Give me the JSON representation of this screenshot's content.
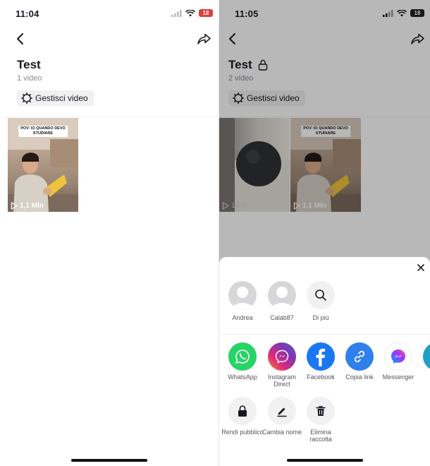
{
  "left_screen": {
    "status_time": "11:04",
    "battery": "18",
    "collection_title": "Test",
    "video_count": "1 video",
    "manage_label": "Gestisci video",
    "videos": [
      {
        "caption": "POV: IO QUANDO DEVO STUDIARE",
        "views": "1,1 Mln"
      }
    ]
  },
  "right_screen": {
    "status_time": "11:05",
    "battery": "18",
    "collection_title": "Test",
    "video_count": "2 video",
    "manage_label": "Gestisci video",
    "videos": [
      {
        "caption": "",
        "views": "1896"
      },
      {
        "caption": "POV: IO QUANDO DEVO STUDIARE",
        "views": "1,1 Mln"
      }
    ],
    "share_sheet": {
      "contacts": [
        {
          "label": "Andrea",
          "icon": "avatar-placeholder"
        },
        {
          "label": "Calab87",
          "icon": "avatar-placeholder"
        },
        {
          "label": "Di più",
          "icon": "search-icon"
        }
      ],
      "apps": [
        {
          "label": "WhatsApp",
          "icon": "whatsapp-icon",
          "color": "#25D366"
        },
        {
          "label": "Instagram Direct",
          "icon": "instagram-direct-icon",
          "color": "#C13584"
        },
        {
          "label": "Facebook",
          "icon": "facebook-icon",
          "color": "#1877F2"
        },
        {
          "label": "Copia link",
          "icon": "link-icon",
          "color": "#2F80ED"
        },
        {
          "label": "Messenger",
          "icon": "messenger-icon",
          "color": "#A334FA"
        }
      ],
      "actions": [
        {
          "label": "Rendi pubblico",
          "icon": "lock-icon"
        },
        {
          "label": "Cambia nome",
          "icon": "pencil-icon"
        },
        {
          "label": "Elimina raccolta",
          "icon": "trash-icon"
        }
      ]
    }
  }
}
